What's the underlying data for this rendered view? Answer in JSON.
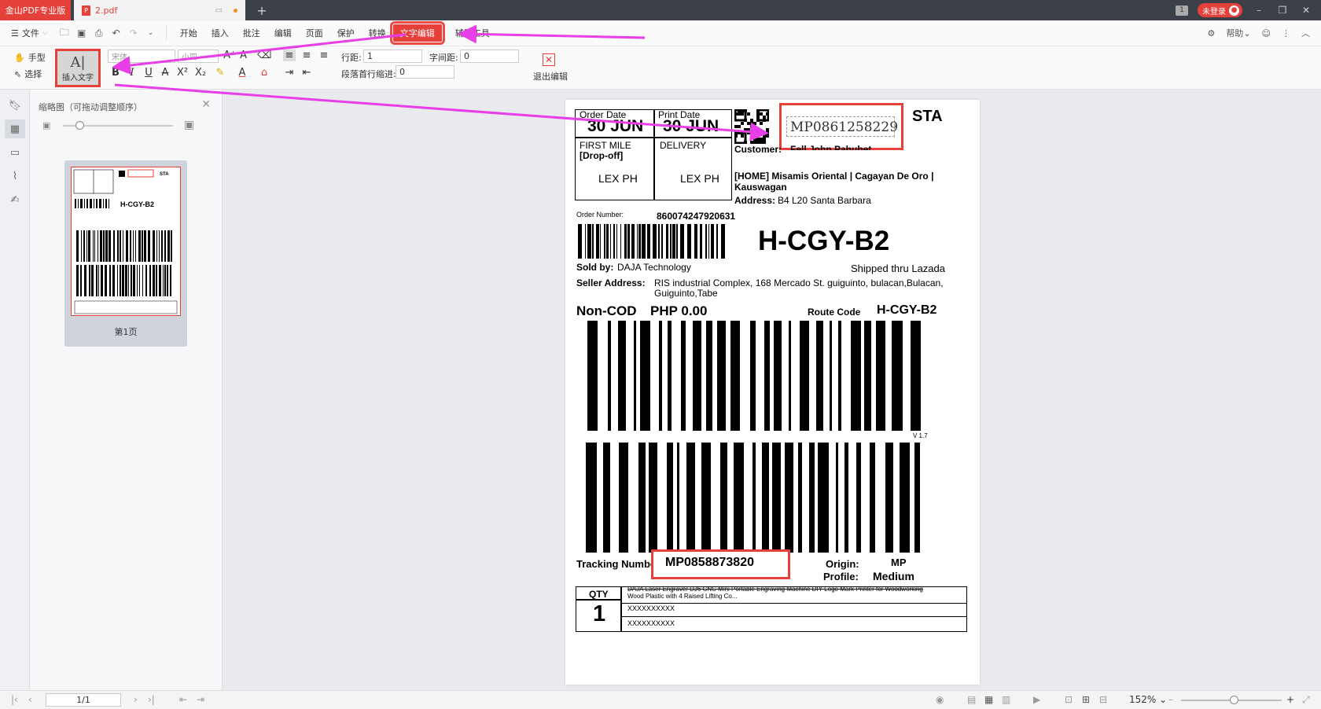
{
  "titlebar": {
    "app_tab": "金山PDF专业版",
    "doc_tab": "2.pdf",
    "new_tab": "+",
    "page_badge": "1",
    "login_label": "未登录"
  },
  "menubar": {
    "file": "文件",
    "items": [
      "开始",
      "插入",
      "批注",
      "编辑",
      "页面",
      "保护",
      "转换",
      "文字编辑",
      "辅助工具"
    ],
    "help": "帮助"
  },
  "ribbon": {
    "hand": "手型",
    "select": "选择",
    "insert_text": "插入文字",
    "font_name": "宋体",
    "font_size": "小四",
    "line_spacing_label": "行距:",
    "line_spacing_value": "1",
    "char_spacing_label": "字间距:",
    "char_spacing_value": "0",
    "indent_label": "段落首行缩进:",
    "indent_value": "0",
    "exit_edit": "退出编辑"
  },
  "thumbnails": {
    "title": "缩略图（可拖动调整顺序）",
    "page_label": "第1页"
  },
  "label": {
    "order_date_label": "Order Date",
    "order_date_value": "30 JUN",
    "print_date_label": "Print Date",
    "print_date_value": "30 JUN",
    "first_mile": "FIRST MILE",
    "drop_off": "[Drop-off]",
    "delivery": "DELIVERY",
    "lex1": "LEX PH",
    "lex2": "LEX PH",
    "tracking_top": "MP0861258229",
    "sta": "STA",
    "customer_label": "Customer:",
    "customer_name": "Fell John Pahuhet",
    "address_line1": "[HOME] Misamis Oriental | Cagayan De Oro |",
    "address_line2": "Kauswagan",
    "address_label": "Address:",
    "address_value": "B4 L20 Santa Barbara",
    "order_number_label": "Order Number:",
    "order_number": "860074247920631",
    "route_big": "H-CGY-B2",
    "sold_by_label": "Sold by:",
    "sold_by": "DAJA Technology",
    "shipped": "Shipped thru Lazada",
    "seller_address_label": "Seller Address:",
    "seller_address_1": "RIS industrial Complex, 168 Mercado St. guiguinto, bulacan,Bulacan,",
    "seller_address_2": "Guiguinto,Tabe",
    "cod": "Non-COD",
    "php": "PHP 0.00",
    "route_code_label": "Route Code",
    "route_code": "H-CGY-B2",
    "version": "V 1.7",
    "tracking_label": "Tracking Number",
    "tracking_number": "MP0858873820",
    "origin_label": "Origin:",
    "origin_value": "MP",
    "profile_label": "Profile:",
    "profile_value": "Medium",
    "qty_label": "QTY",
    "qty_value": "1",
    "product_1": "DAJA Laser Engraver DJ6 CNC Mini Portable Engraving Machine DIY Logo Mark Printer for Woodworking",
    "product_2": "Wood Plastic with 4 Raised Lifting Co...",
    "xrow1": "XXXXXXXXXX",
    "xrow2": "XXXXXXXXXX"
  },
  "statusbar": {
    "page_input": "1/1",
    "zoom": "152%"
  },
  "colors": {
    "accent": "#e5403a",
    "arrow": "#e83ee8"
  }
}
